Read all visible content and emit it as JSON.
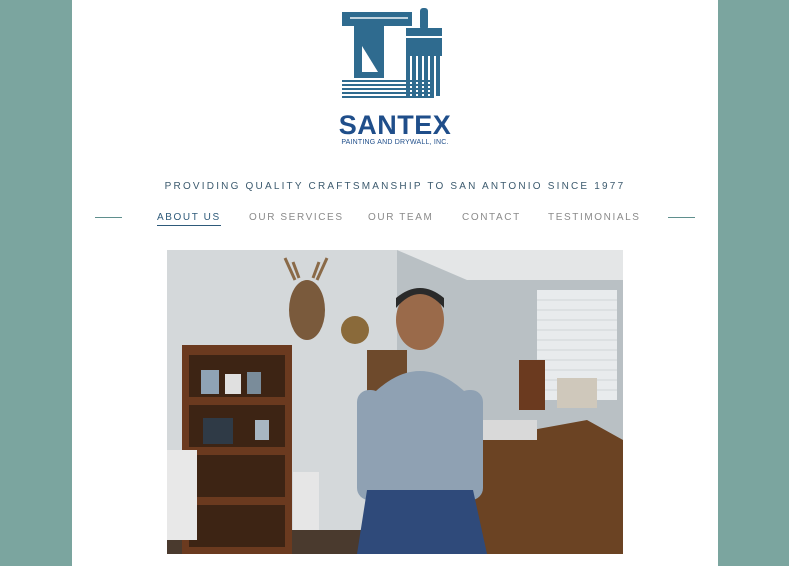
{
  "brand": {
    "name": "SANTEX",
    "subtitle": "PAINTING AND DRYWALL, INC."
  },
  "tagline": "PROVIDING QUALITY CRAFTSMANSHIP TO SAN ANTONIO SINCE 1977",
  "nav": {
    "items": [
      {
        "label": "ABOUT US",
        "active": true
      },
      {
        "label": "OUR SERVICES",
        "active": false
      },
      {
        "label": "OUR TEAM",
        "active": false
      },
      {
        "label": "CONTACT",
        "active": false
      },
      {
        "label": "TESTIMONIALS",
        "active": false
      }
    ]
  },
  "colors": {
    "background": "#7ba59f",
    "brand_blue": "#2f6b8f",
    "nav_active": "#2e5a7a",
    "nav_inactive": "#8a8a8a"
  }
}
